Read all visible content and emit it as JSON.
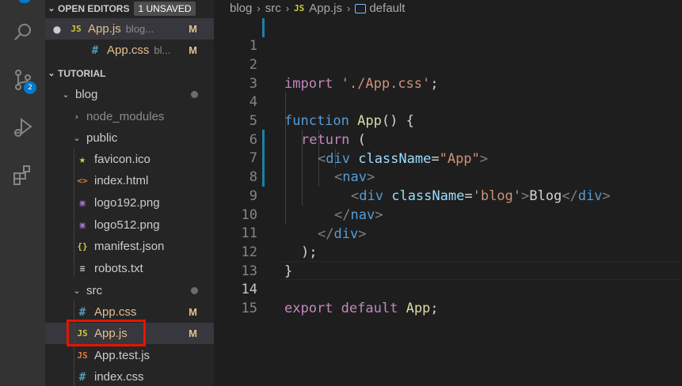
{
  "activity_bar": {
    "icons": [
      "explorer-icon",
      "search-icon",
      "source-control-icon",
      "run-debug-icon",
      "extensions-icon"
    ],
    "source_control_badge": "2"
  },
  "sidebar": {
    "open_editors": {
      "title": "OPEN EDITORS",
      "unsaved_badge": "1 UNSAVED",
      "items": [
        {
          "icon": "JS",
          "name": "App.js",
          "desc": "blog...",
          "flag": "M"
        },
        {
          "icon": "#",
          "name": "App.css",
          "desc": "bl...",
          "flag": "M"
        }
      ]
    },
    "tutorial": {
      "title": "TUTORIAL",
      "tree": [
        {
          "name": "blog"
        },
        {
          "name": "node_modules"
        },
        {
          "name": "public"
        },
        {
          "icon": "★",
          "name": "favicon.ico"
        },
        {
          "icon": "<>",
          "name": "index.html"
        },
        {
          "icon": "▣",
          "name": "logo192.png"
        },
        {
          "icon": "▣",
          "name": "logo512.png"
        },
        {
          "icon": "{}",
          "name": "manifest.json"
        },
        {
          "icon": "≡",
          "name": "robots.txt"
        },
        {
          "name": "src"
        },
        {
          "icon": "#",
          "name": "App.css",
          "flag": "M"
        },
        {
          "icon": "JS",
          "name": "App.js",
          "flag": "M"
        },
        {
          "icon": "JS",
          "name": "App.test.js"
        },
        {
          "icon": "#",
          "name": "index.css"
        }
      ]
    }
  },
  "editor": {
    "breadcrumb": {
      "parts": [
        "blog",
        "src",
        "App.js",
        "default"
      ],
      "file_icon": "JS"
    },
    "line_numbers": [
      "1",
      "2",
      "3",
      "4",
      "5",
      "6",
      "7",
      "8",
      "9",
      "10",
      "11",
      "12",
      "13",
      "14",
      "15"
    ],
    "tokens": {
      "l2_import": "import",
      "l2_str": "'./App.css'",
      "l2_semi": ";",
      "l4_function": "function",
      "l4_name": "App",
      "l4_rest": "() {",
      "l5_return": "return",
      "l5_rest": " (",
      "l6_open": "<",
      "l6_div": "div",
      "l6_attr": "className",
      "l6_eq": "=",
      "l6_str": "\"App\"",
      "l6_close": ">",
      "l7_open": "<",
      "l7_nav": "nav",
      "l7_close": ">",
      "l8_open": "<",
      "l8_div": "div",
      "l8_attr": "className",
      "l8_eq": "=",
      "l8_str": "'blog'",
      "l8_close": ">",
      "l8_text": "Blog",
      "l8_endopen": "</",
      "l8_enddiv": "div",
      "l8_endclose": ">",
      "l9_open": "</",
      "l9_nav": "nav",
      "l9_close": ">",
      "l10_open": "</",
      "l10_div": "div",
      "l10_close": ">",
      "l11": ");",
      "l12": "}",
      "l14_export": "export",
      "l14_default": "default",
      "l14_app": "App",
      "l14_semi": ";"
    }
  }
}
